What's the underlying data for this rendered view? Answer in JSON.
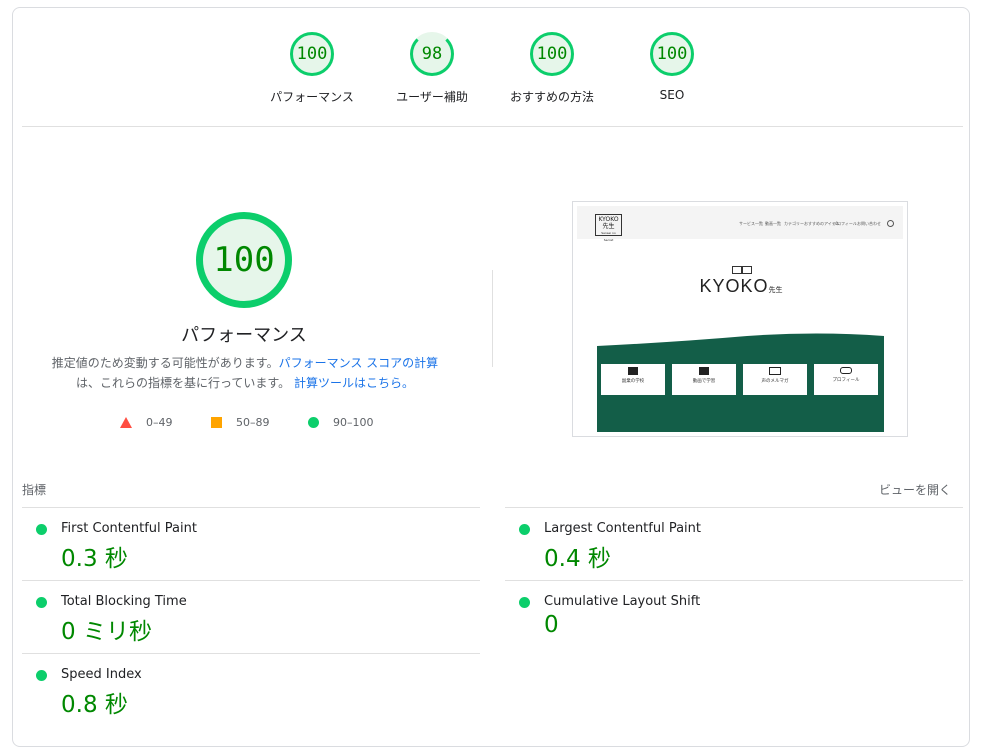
{
  "categories": [
    {
      "score": "100",
      "label": "パフォーマンス"
    },
    {
      "score": "98",
      "label": "ユーザー補助"
    },
    {
      "score": "100",
      "label": "おすすめの方法"
    },
    {
      "score": "100",
      "label": "SEO"
    }
  ],
  "main": {
    "score": "100",
    "title": "パフォーマンス",
    "desc_prefix": "推定値のため変動する可能性があります。",
    "desc_link": "パフォーマンス スコアの計算",
    "desc_middle": "は、これらの指標を基に行っています。",
    "desc_link2": "計算ツールはこちら。"
  },
  "legend": {
    "fail": "0–49",
    "average": "50–89",
    "pass": "90–100"
  },
  "thumbnail": {
    "logo_line1": "KYOKO",
    "logo_line2": "先生",
    "logo_line3": "Sensei no Secret",
    "menu": [
      "サービス一覧",
      "動画一覧",
      "カテゴリー",
      "おすすめのアイテム",
      "プロフィール",
      "お問い合わせ"
    ],
    "brand": "KYOKO",
    "brand_sub": "先生",
    "tiles": [
      "副業の学校",
      "動画で学習",
      "声のメルマガ",
      "プロフィール"
    ]
  },
  "metrics": {
    "heading": "指標",
    "toggle": "ビューを開く",
    "items": [
      {
        "title": "First Contentful Paint",
        "value": "0.3 秒"
      },
      {
        "title": "Largest Contentful Paint",
        "value": "0.4 秒"
      },
      {
        "title": "Total Blocking Time",
        "value": "0 ミリ秒"
      },
      {
        "title": "Cumulative Layout Shift",
        "value": "0"
      },
      {
        "title": "Speed Index",
        "value": "0.8 秒"
      }
    ]
  },
  "colors": {
    "pass": "#0cce6b",
    "average": "#ffa400",
    "fail": "#ff4e42",
    "score_text": "#008800",
    "link": "#1a73e8"
  }
}
